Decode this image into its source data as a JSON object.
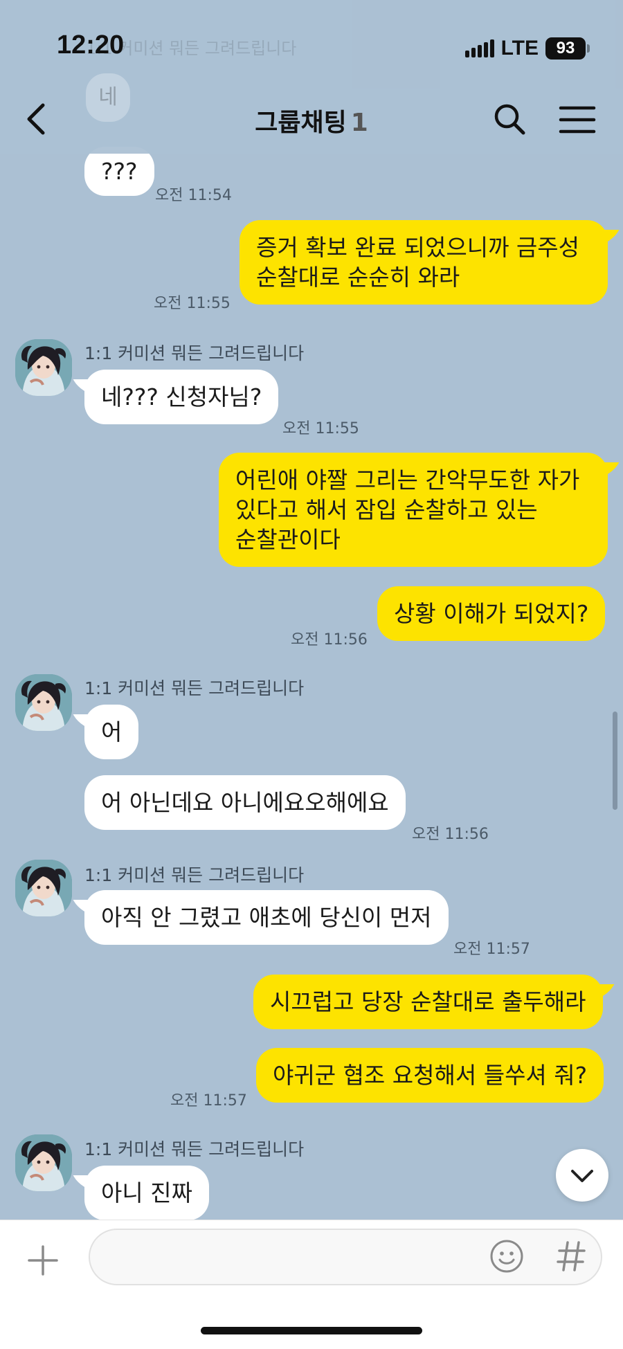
{
  "status_bar": {
    "time": "12:20",
    "network": "LTE",
    "battery": "93"
  },
  "header": {
    "title": "그룹채팅",
    "member_count": "1"
  },
  "background_ghost": {
    "sender": "1:1 커미션 뭐든 그려드립니다",
    "bubble": "네"
  },
  "messages": [
    {
      "id": "m1",
      "side": "in",
      "text": "???",
      "time": "오전 11:54"
    },
    {
      "id": "m2",
      "side": "out",
      "lines": [
        "증거 확보 완료 되었으니까 금주성",
        "순찰대로 순순히 와라"
      ],
      "time": "오전 11:55"
    },
    {
      "id": "m3",
      "side": "in",
      "sender": "1:1 커미션 뭐든 그려드립니다",
      "text": "네??? 신청자님?",
      "time": "오전 11:55"
    },
    {
      "id": "m4",
      "side": "out",
      "lines": [
        "어린애 야짤 그리는 간악무도한 자가",
        "있다고 해서 잠입 순찰하고 있는",
        "순찰관이다"
      ]
    },
    {
      "id": "m5",
      "side": "out",
      "text": "상황 이해가 되었지?",
      "time": "오전 11:56"
    },
    {
      "id": "m6",
      "side": "in",
      "sender": "1:1 커미션 뭐든 그려드립니다",
      "text": "어"
    },
    {
      "id": "m7",
      "side": "in",
      "text": "어 아닌데요 아니에요오해에요",
      "time": "오전 11:56"
    },
    {
      "id": "m8",
      "side": "in",
      "sender": "1:1 커미션 뭐든 그려드립니다",
      "text": "아직 안 그렸고 애초에 당신이 먼저",
      "time": "오전 11:57"
    },
    {
      "id": "m9",
      "side": "out",
      "text": "시끄럽고 당장 순찰대로 출두해라"
    },
    {
      "id": "m10",
      "side": "out",
      "text": "야귀군 협조 요청해서 들쑤셔 줘?",
      "time": "오전 11:57"
    },
    {
      "id": "m11",
      "side": "in",
      "sender": "1:1 커미션 뭐든 그려드립니다",
      "text": "아니 진짜"
    }
  ],
  "input": {
    "placeholder": "",
    "value": ""
  },
  "icons": {
    "back": "chevron-left-icon",
    "search": "search-icon",
    "menu": "hamburger-menu-icon",
    "scroll_down": "chevron-down-icon",
    "plus": "plus-icon",
    "emoji": "smiley-icon",
    "hash": "hash-icon"
  },
  "colors": {
    "chat_background": "#abc0d3",
    "outgoing_bubble": "#fde300",
    "incoming_bubble": "#ffffff"
  }
}
